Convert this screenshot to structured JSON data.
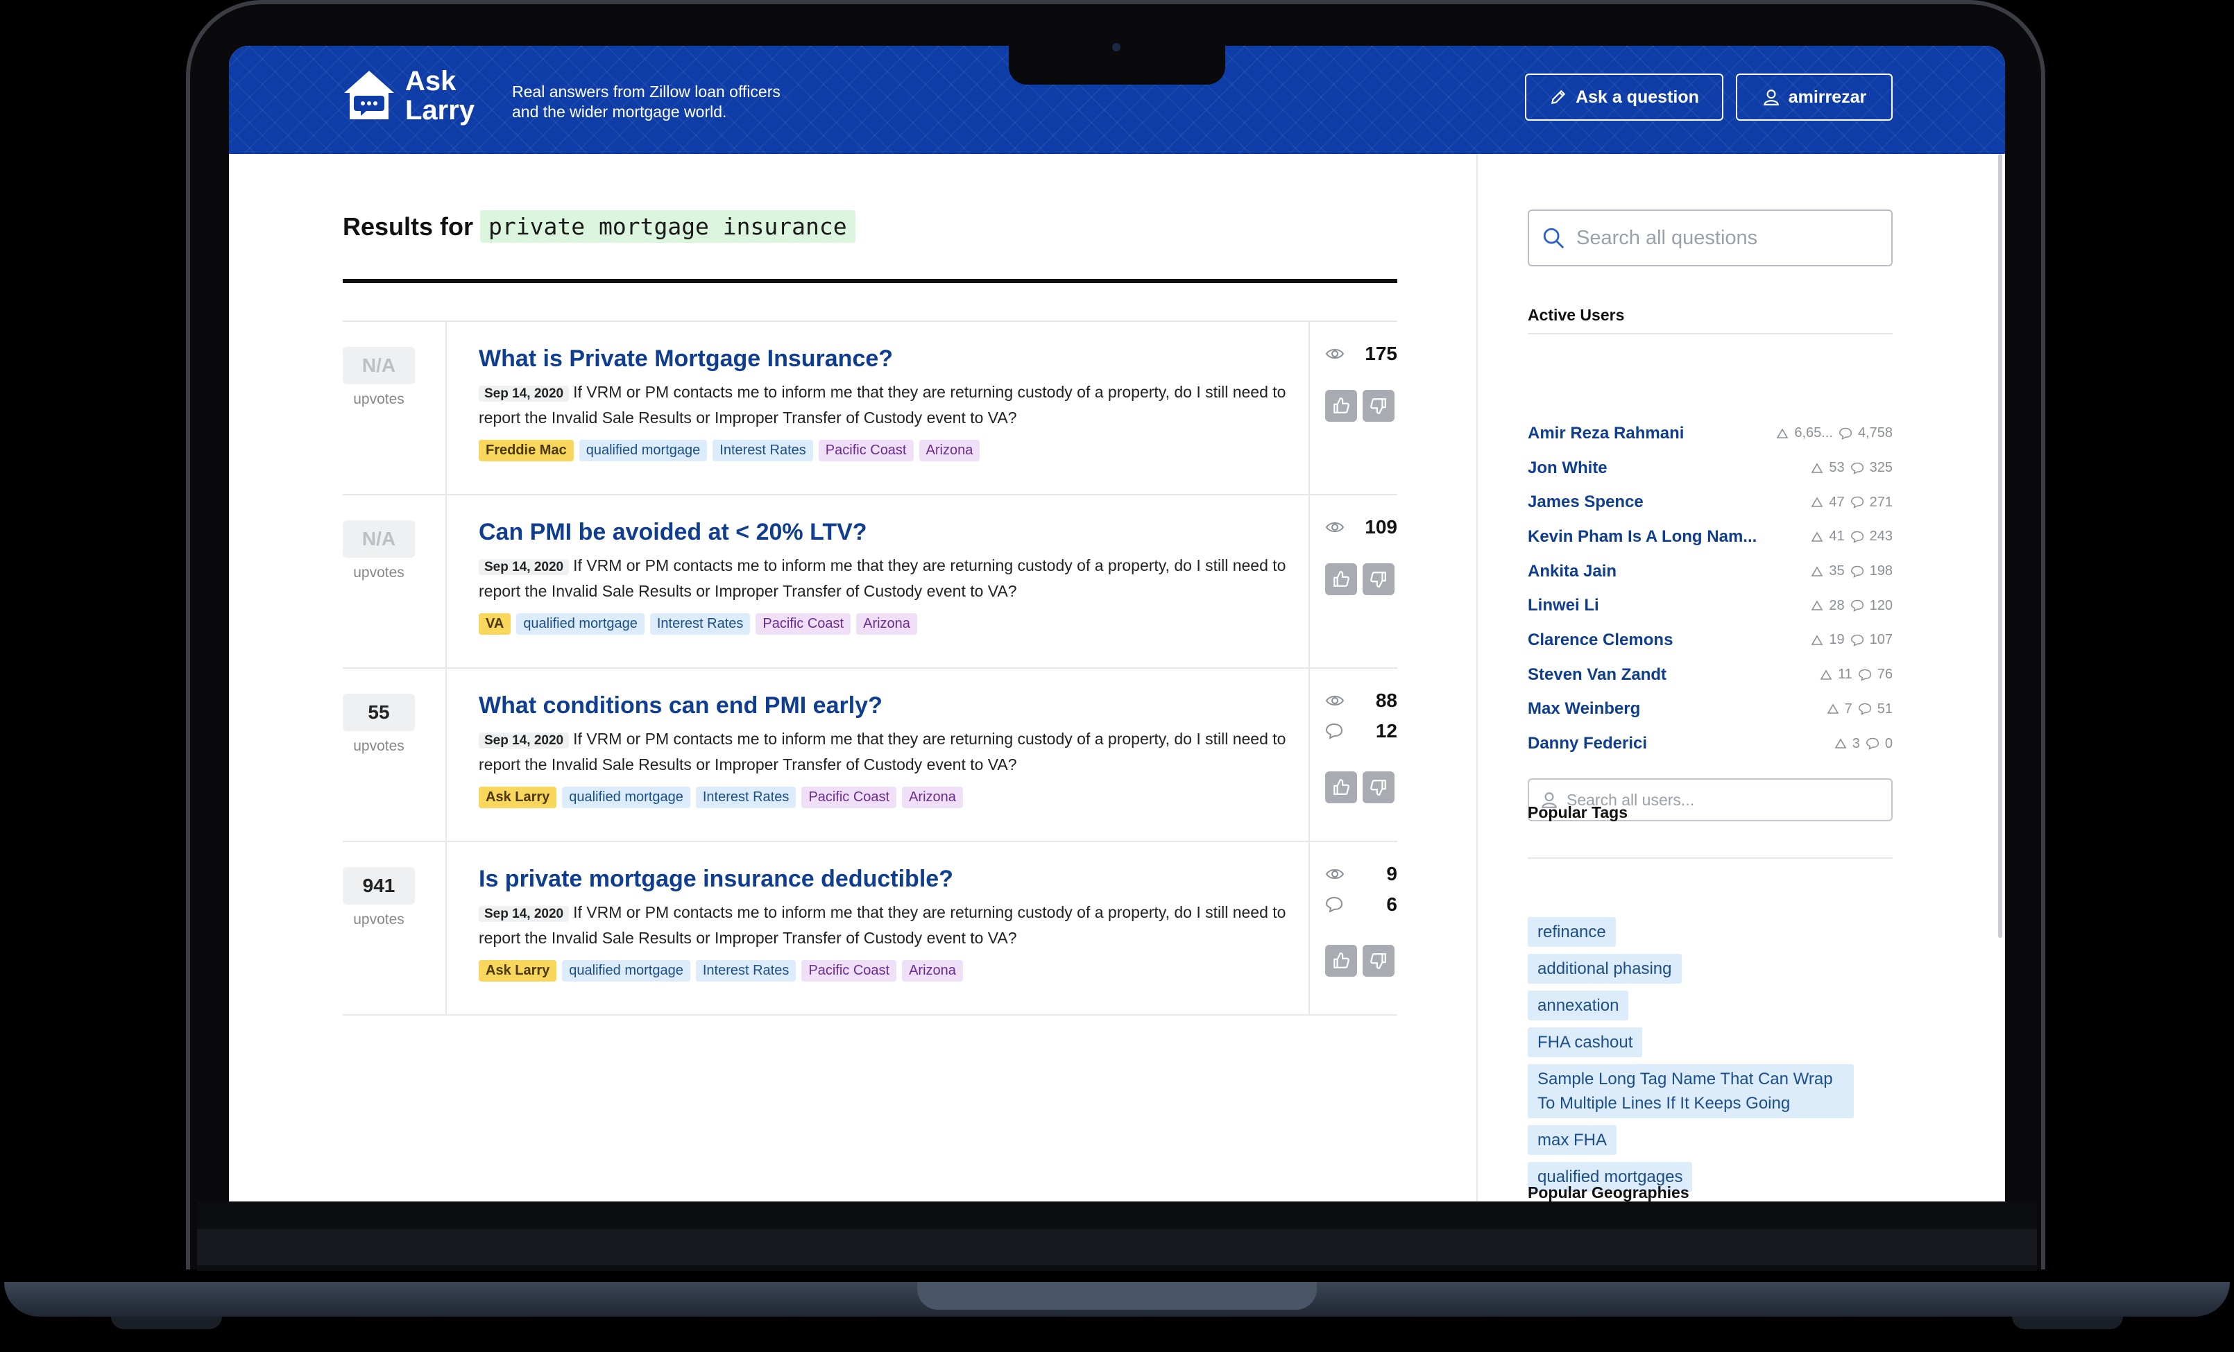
{
  "header": {
    "logo_line1": "Ask",
    "logo_line2": "Larry",
    "tagline_line1": "Real answers from Zillow loan officers",
    "tagline_line2": "and the wider mortgage world.",
    "ask_button": "Ask a question",
    "user_button": "amirrezar",
    "brand_color": "#0f3da8"
  },
  "results": {
    "prefix": "Results for",
    "query": "private mortgage insurance"
  },
  "questions": [
    {
      "votes": "N/A",
      "votes_label": "upvotes",
      "title": "What is Private Mortgage Insurance?",
      "date": "Sep 14, 2020",
      "excerpt": "If VRM or PM contacts me to inform me that they are returning custody of a property, do I still need to report the Invalid Sale Results or Improper Transfer of Custody event to VA?",
      "tags": [
        "Freddie Mac",
        "qualified mortgage",
        "Interest Rates",
        "Pacific Coast",
        "Arizona"
      ],
      "views": "175",
      "comments": null
    },
    {
      "votes": "N/A",
      "votes_label": "upvotes",
      "title": "Can PMI be avoided at < 20% LTV?",
      "date": "Sep 14, 2020",
      "excerpt": "If VRM or PM contacts me to inform me that they are returning custody of a property, do I still need to report the Invalid Sale Results or Improper Transfer of Custody event to VA?",
      "tags": [
        "VA",
        "qualified mortgage",
        "Interest Rates",
        "Pacific Coast",
        "Arizona"
      ],
      "views": "109",
      "comments": null
    },
    {
      "votes": "55",
      "votes_label": "upvotes",
      "title": "What conditions can end PMI early?",
      "date": "Sep 14, 2020",
      "excerpt": "If VRM or PM contacts me to inform me that they are returning custody of a property, do I still need to report the Invalid Sale Results or Improper Transfer of Custody event to VA?",
      "tags": [
        "Ask Larry",
        "qualified mortgage",
        "Interest Rates",
        "Pacific Coast",
        "Arizona"
      ],
      "views": "88",
      "comments": "12"
    },
    {
      "votes": "941",
      "votes_label": "upvotes",
      "title": "Is private mortgage insurance deductible?",
      "date": "Sep 14, 2020",
      "excerpt": "If VRM or PM contacts me to inform me that they are returning custody of a property, do I still need to report the Invalid Sale Results or Improper Transfer of Custody event to VA?",
      "tags": [
        "Ask Larry",
        "qualified mortgage",
        "Interest Rates",
        "Pacific Coast",
        "Arizona"
      ],
      "views": "9",
      "comments": "6"
    }
  ],
  "sidebar": {
    "search_placeholder": "Search all questions",
    "active_users_title": "Active Users",
    "users": [
      {
        "name": "Amir Reza Rahmani",
        "score": "6,65...",
        "comments": "4,758"
      },
      {
        "name": "Jon White",
        "score": "53",
        "comments": "325"
      },
      {
        "name": "James Spence",
        "score": "47",
        "comments": "271"
      },
      {
        "name": "Kevin Pham Is A Long Nam...",
        "score": "41",
        "comments": "243"
      },
      {
        "name": "Ankita Jain",
        "score": "35",
        "comments": "198"
      },
      {
        "name": "Linwei Li",
        "score": "28",
        "comments": "120"
      },
      {
        "name": "Clarence Clemons",
        "score": "19",
        "comments": "107"
      },
      {
        "name": "Steven Van Zandt",
        "score": "11",
        "comments": "76"
      },
      {
        "name": "Max Weinberg",
        "score": "7",
        "comments": "51"
      },
      {
        "name": "Danny Federici",
        "score": "3",
        "comments": "0"
      }
    ],
    "user_search_placeholder": "Search all users...",
    "popular_tags_title": "Popular Tags",
    "popular_tags": [
      "refinance",
      "additional phasing",
      "annexation",
      "FHA cashout",
      "Sample Long Tag Name That Can Wrap To Multiple Lines If It Keeps Going",
      "max FHA",
      "qualified mortgages"
    ],
    "popular_geographies_title": "Popular Geographies"
  },
  "icons": {
    "logo": "house-chat-icon",
    "ask": "pencil-icon",
    "user": "user-icon",
    "search": "search-icon",
    "views": "eye-icon",
    "comments": "comment-icon",
    "upvote": "thumbs-up-icon",
    "downvote": "thumbs-down-icon",
    "score": "triangle-icon"
  }
}
